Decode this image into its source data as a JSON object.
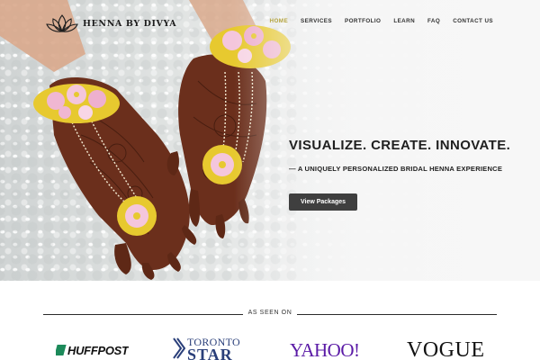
{
  "brand": {
    "name": "HENNA BY DIVYA",
    "logo_icon": "lotus-icon"
  },
  "nav": {
    "items": [
      {
        "label": "HOME",
        "active": true
      },
      {
        "label": "SERVICES",
        "active": false
      },
      {
        "label": "PORTFOLIO",
        "active": false
      },
      {
        "label": "LEARN",
        "active": false
      },
      {
        "label": "FAQ",
        "active": false
      },
      {
        "label": "CONTACT US",
        "active": false
      }
    ],
    "active_color": "#b6a53f"
  },
  "hero": {
    "headline": "VISUALIZE. CREATE. INNOVATE.",
    "subheadline": "— A UNIQUELY PERSONALIZED BRIDAL HENNA EXPERIENCE",
    "cta_label": "View Packages",
    "image_subject": "henna-decorated hands with floral bracelets"
  },
  "press": {
    "label": "AS SEEN ON",
    "logos": {
      "huffpost": "HUFFPOST",
      "toronto_star_top": "TORONTO",
      "toronto_star_bottom": "STAR",
      "yahoo": "YAHOO!",
      "vogue": "VOGUE"
    },
    "colors": {
      "huffpost_green": "#1c8a5a",
      "star_blue": "#2a3f7a",
      "yahoo_purple": "#5a1aa6"
    }
  }
}
